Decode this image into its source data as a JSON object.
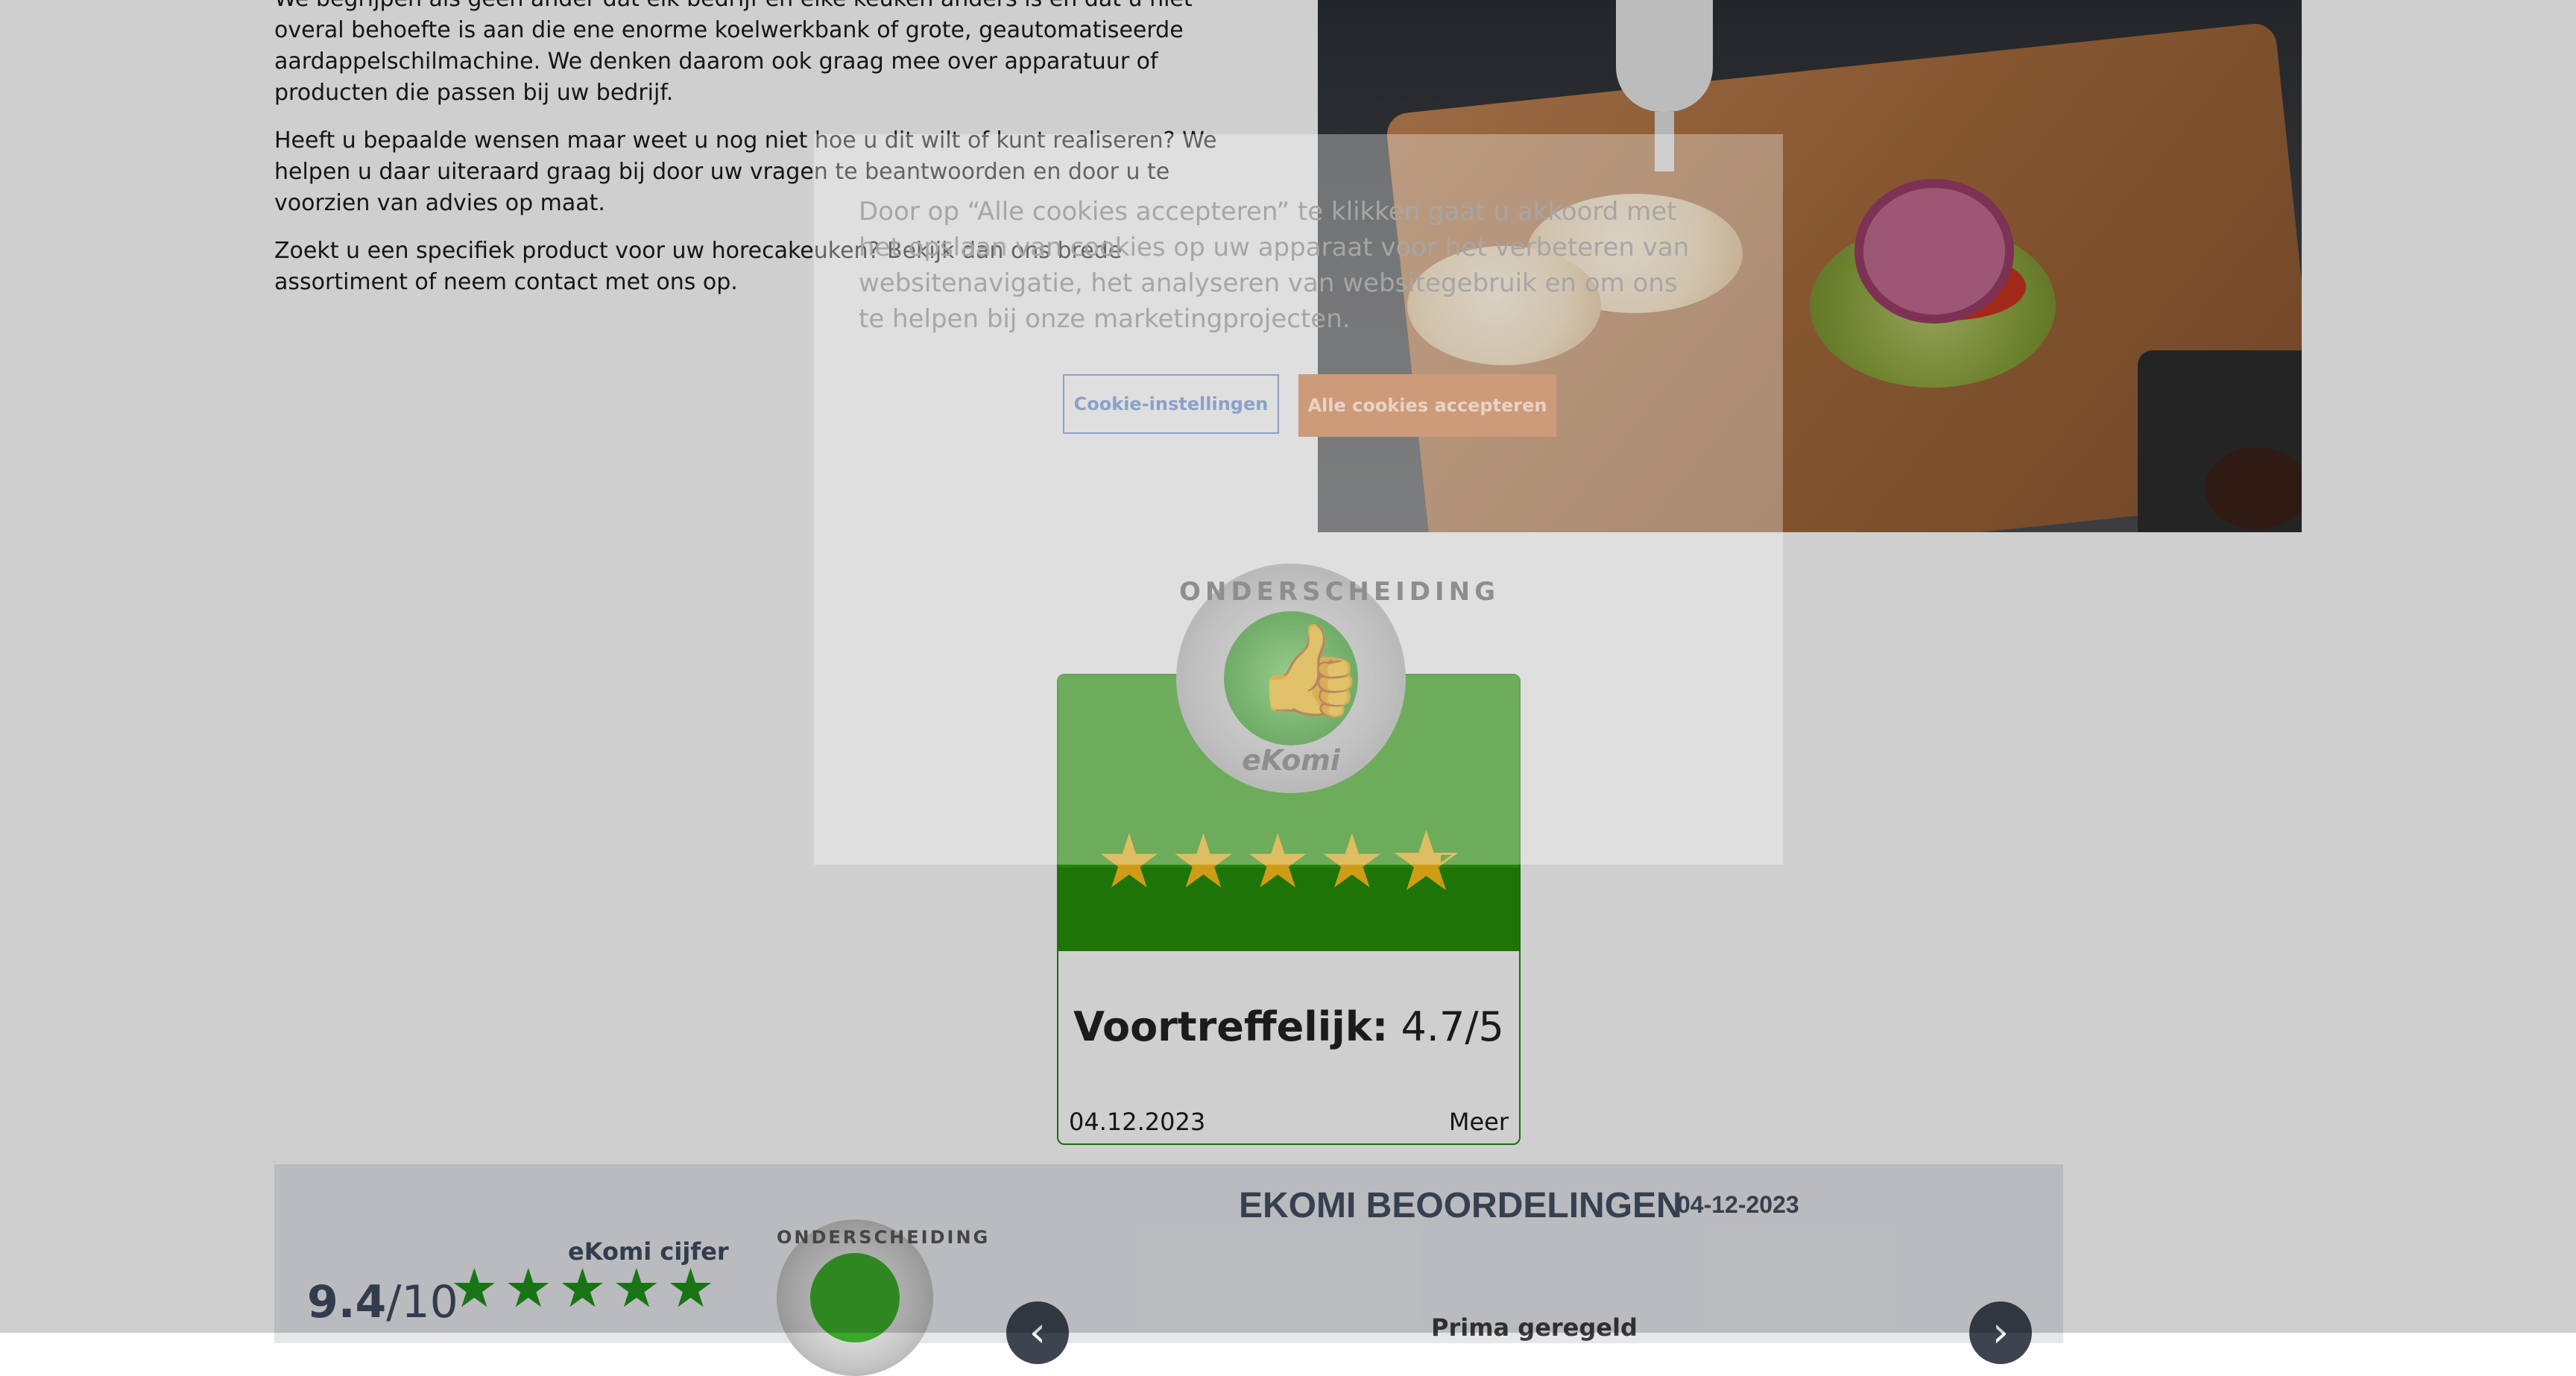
{
  "content": {
    "paragraph_1": "We begrijpen als geen ander dat elk bedrijf en elke keuken anders is en dat u niet overal behoefte is aan die ene enorme koelwerkbank of grote, geautomatiseerde aardappelschilmachine. We denken daarom ook graag mee over apparatuur of producten die passen bij uw bedrijf.",
    "paragraph_2": "Heeft u bepaalde wensen maar weet u nog niet hoe u dit wilt of kunt realiseren? We helpen u daar uiteraard graag bij door uw vragen te beantwoorden en door u te voorzien van advies op maat.",
    "paragraph_3": "Zoekt u een specifiek product voor uw horecakeuken? Bekijk dan ons brede assortiment of neem contact met ons op."
  },
  "ekomi_widget": {
    "seal_top_text": "ONDERSCHEIDING",
    "seal_bottom_text": "eKomi",
    "rating_stars": 4.7,
    "verdict_label": "Voortreffelijk:",
    "verdict_score": "4.7/5",
    "date": "04.12.2023",
    "more_link": "Meer",
    "colors": {
      "green": "#2ea30e",
      "dark_green": "#258f08",
      "star": "#ffc21a"
    }
  },
  "ekomi_band": {
    "score": "9.4",
    "score_suffix": "/10",
    "cijfer_label": "eKomi cijfer",
    "seal_text": "ONDERSCHEIDING",
    "heading": "EKOMI BEOORDELINGEN",
    "heading_date": "04-12-2023",
    "review_title": "Prima geregeld",
    "prev_icon": "chevron-left-icon",
    "next_icon": "chevron-right-icon"
  },
  "cookie_banner": {
    "message": "Door op “Alle cookies accepteren” te klikken gaat u akkoord met het opslaan van cookies op uw apparaat voor het verbeteren van websitenavigatie, het analyseren van websitegebruik en om ons te helpen bij onze marketingprojecten.",
    "settings_button": "Cookie-instellingen",
    "accept_button": "Alle cookies accepteren",
    "colors": {
      "accept": "#cd9a7a",
      "settings_border": "#8aa1c9"
    }
  }
}
